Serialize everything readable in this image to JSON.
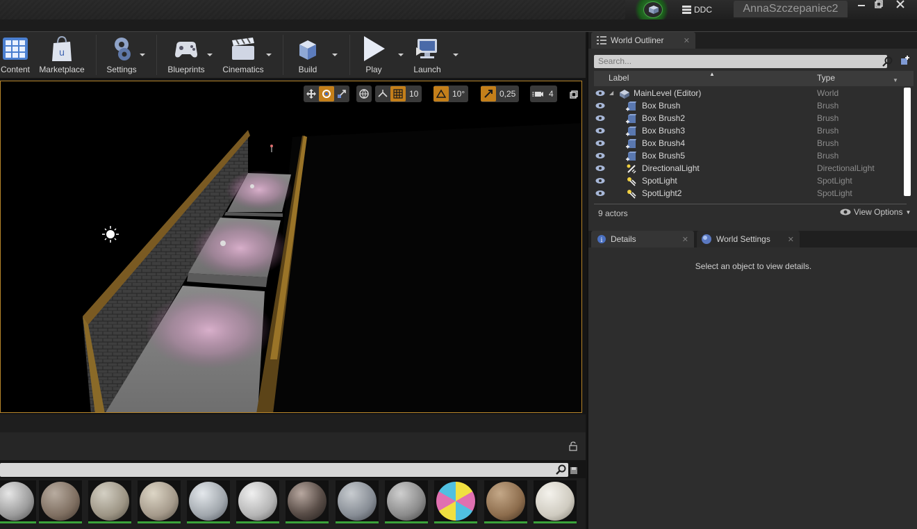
{
  "titlebar": {
    "ddc_label": "DDC",
    "user_tab": "AnnaSzczepaniec2",
    "window_buttons": [
      "minimize-icon",
      "restore-icon",
      "close-icon"
    ]
  },
  "toolbar": {
    "items": [
      {
        "label": "Content",
        "icon": "content-grid-icon",
        "has_menu": false
      },
      {
        "label": "Marketplace",
        "icon": "marketplace-bag-icon",
        "has_menu": false
      },
      {
        "label": "Settings",
        "icon": "settings-gears-icon",
        "has_menu": true
      },
      {
        "label": "Blueprints",
        "icon": "blueprints-gamepad-icon",
        "has_menu": true
      },
      {
        "label": "Cinematics",
        "icon": "cinematics-clapper-icon",
        "has_menu": true
      },
      {
        "label": "Build",
        "icon": "build-blocks-icon",
        "has_menu": true
      },
      {
        "label": "Play",
        "icon": "play-icon",
        "has_menu": true
      },
      {
        "label": "Launch",
        "icon": "launch-monitor-icon",
        "has_menu": true
      }
    ]
  },
  "viewport": {
    "grid_snap": "10",
    "rotation_snap": "10°",
    "scale_snap": "0,25",
    "camera_speed": "4"
  },
  "world_outliner": {
    "tab_label": "World Outliner",
    "search_placeholder": "Search...",
    "col_label": "Label",
    "col_type": "Type",
    "rows": [
      {
        "name": "MainLevel (Editor)",
        "type": "World",
        "icon": "world-icon"
      },
      {
        "name": "Box Brush",
        "type": "Brush",
        "icon": "brush-icon"
      },
      {
        "name": "Box Brush2",
        "type": "Brush",
        "icon": "brush-icon"
      },
      {
        "name": "Box Brush3",
        "type": "Brush",
        "icon": "brush-icon"
      },
      {
        "name": "Box Brush4",
        "type": "Brush",
        "icon": "brush-icon"
      },
      {
        "name": "Box Brush5",
        "type": "Brush",
        "icon": "brush-icon"
      },
      {
        "name": "DirectionalLight",
        "type": "DirectionalLight",
        "icon": "directional-light-icon"
      },
      {
        "name": "SpotLight",
        "type": "SpotLight",
        "icon": "spotlight-icon"
      },
      {
        "name": "SpotLight2",
        "type": "SpotLight",
        "icon": "spotlight-icon"
      }
    ],
    "actor_count": "9 actors",
    "view_options": "View Options"
  },
  "details": {
    "tabs": [
      "Details",
      "World Settings"
    ],
    "empty_message": "Select an object to view details."
  },
  "colors": {
    "accent_orange": "#c47f1a",
    "viewport_border": "#b8862a",
    "asset_underline": "#3aa33a"
  }
}
